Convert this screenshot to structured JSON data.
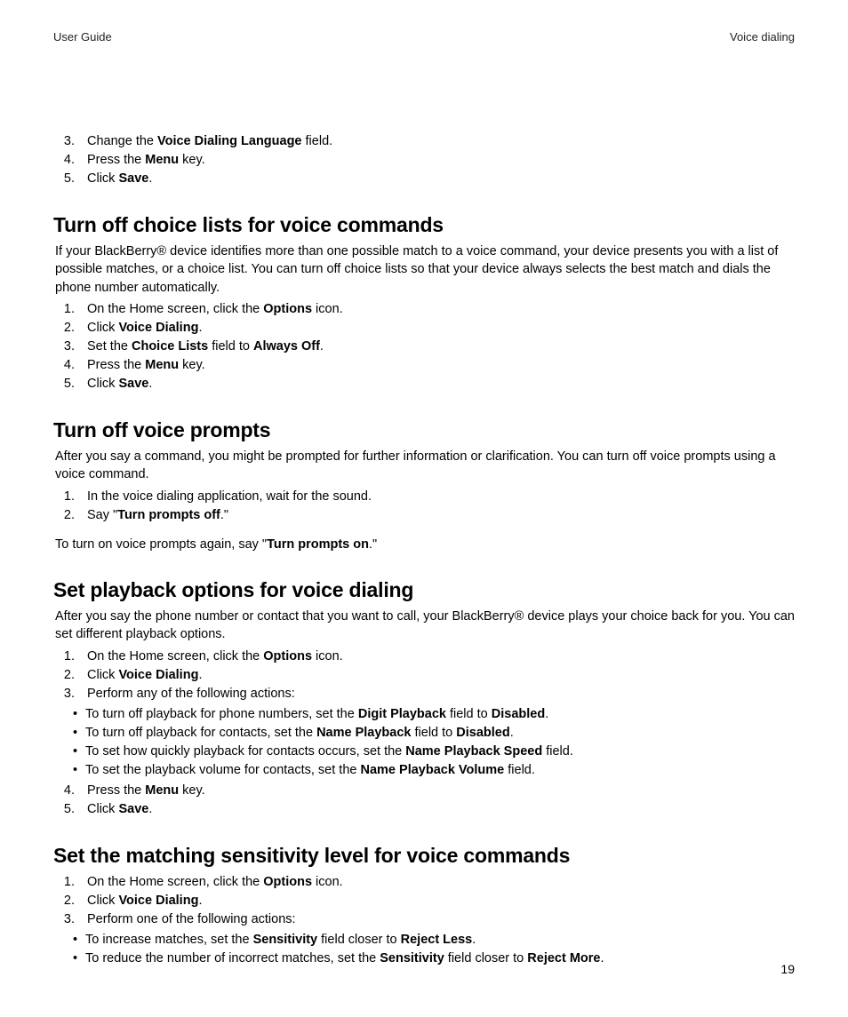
{
  "header": {
    "left": "User Guide",
    "right": "Voice dialing"
  },
  "page_number": "19",
  "intro_ol_start": 3,
  "intro_steps": [
    {
      "pre": "Change the ",
      "b1": "Voice Dialing Language",
      "post": " field."
    },
    {
      "pre": "Press the ",
      "b1": "Menu",
      "post": " key."
    },
    {
      "pre": "Click ",
      "b1": "Save",
      "post": "."
    }
  ],
  "s1": {
    "title": "Turn off choice lists for voice commands",
    "intro": "If your BlackBerry® device identifies more than one possible match to a voice command, your device presents you with a list of possible matches, or a choice list. You can turn off choice lists so that your device always selects the best match and dials the phone number automatically.",
    "steps": [
      {
        "pre": "On the Home screen, click the ",
        "b1": "Options",
        "post": " icon."
      },
      {
        "pre": "Click ",
        "b1": "Voice Dialing",
        "post": "."
      },
      {
        "pre": "Set the ",
        "b1": "Choice Lists",
        "mid": " field to ",
        "b2": "Always Off",
        "post": "."
      },
      {
        "pre": "Press the ",
        "b1": "Menu",
        "post": " key."
      },
      {
        "pre": "Click ",
        "b1": "Save",
        "post": "."
      }
    ]
  },
  "s2": {
    "title": "Turn off voice prompts",
    "intro": "After you say a command, you might be prompted for further information or clarification. You can turn off voice prompts using a voice command.",
    "steps": [
      {
        "pre": "In the voice dialing application, wait for the sound."
      },
      {
        "pre": "Say \"",
        "b1": "Turn prompts off",
        "post": ".\""
      }
    ],
    "outro_pre": "To turn on voice prompts again, say \"",
    "outro_b": "Turn prompts on",
    "outro_post": ".\""
  },
  "s3": {
    "title": "Set playback options for voice dialing",
    "intro": "After you say the phone number or contact that you want to call, your BlackBerry® device plays your choice back for you. You can set different playback options.",
    "steps_a": [
      {
        "pre": "On the Home screen, click the ",
        "b1": "Options",
        "post": " icon."
      },
      {
        "pre": "Click ",
        "b1": "Voice Dialing",
        "post": "."
      },
      {
        "pre": "Perform any of the following actions:"
      }
    ],
    "bullets": [
      {
        "pre": "To turn off playback for phone numbers, set the ",
        "b1": "Digit Playback",
        "mid": " field to ",
        "b2": "Disabled",
        "post": "."
      },
      {
        "pre": "To turn off playback for contacts, set the ",
        "b1": "Name Playback",
        "mid": " field to ",
        "b2": "Disabled",
        "post": "."
      },
      {
        "pre": "To set how quickly playback for contacts occurs, set the ",
        "b1": "Name Playback Speed",
        "post": " field."
      },
      {
        "pre": "To set the playback volume for contacts, set the ",
        "b1": "Name Playback Volume",
        "post": " field."
      }
    ],
    "steps_b_start": 4,
    "steps_b": [
      {
        "pre": "Press the ",
        "b1": "Menu",
        "post": " key."
      },
      {
        "pre": "Click ",
        "b1": "Save",
        "post": "."
      }
    ]
  },
  "s4": {
    "title": "Set the matching sensitivity level for voice commands",
    "steps": [
      {
        "pre": "On the Home screen, click the ",
        "b1": "Options",
        "post": " icon."
      },
      {
        "pre": "Click ",
        "b1": "Voice Dialing",
        "post": "."
      },
      {
        "pre": "Perform one of the following actions:"
      }
    ],
    "bullets": [
      {
        "pre": "To increase matches, set the ",
        "b1": "Sensitivity",
        "mid": " field closer to ",
        "b2": "Reject Less",
        "post": "."
      },
      {
        "pre": "To reduce the number of incorrect matches, set the ",
        "b1": "Sensitivity",
        "mid": " field closer to ",
        "b2": "Reject More",
        "post": "."
      }
    ]
  }
}
